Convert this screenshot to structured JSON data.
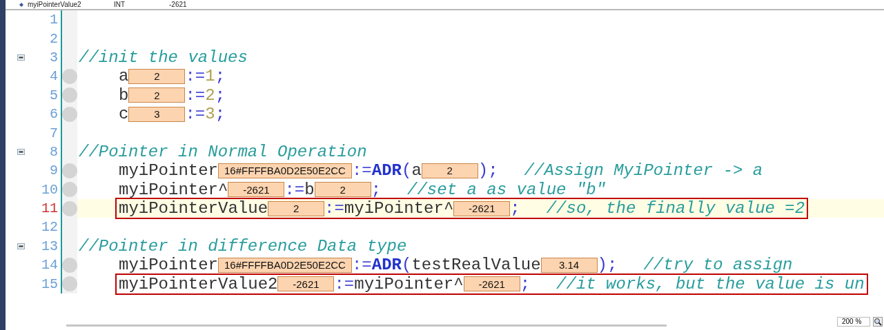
{
  "variables_row": {
    "name": "myiPointerValue2",
    "type": "INT",
    "value": "-2621"
  },
  "lines": [
    {
      "number": "1",
      "foldable": false,
      "breakpoint": false,
      "current": false
    },
    {
      "number": "2",
      "foldable": false,
      "breakpoint": false,
      "current": false
    },
    {
      "number": "3",
      "foldable": true,
      "breakpoint": false,
      "current": false,
      "framed": false,
      "indented": false,
      "tokens": [
        {
          "kind": "comment",
          "text": "//init the values"
        }
      ]
    },
    {
      "number": "4",
      "foldable": false,
      "breakpoint": true,
      "current": false,
      "framed": false,
      "indented": true,
      "tokens": [
        {
          "kind": "ident",
          "text": "a"
        },
        {
          "kind": "value",
          "text": "2"
        },
        {
          "kind": "op",
          "text": ":="
        },
        {
          "kind": "num",
          "text": "1"
        },
        {
          "kind": "punct",
          "text": ";"
        }
      ]
    },
    {
      "number": "5",
      "foldable": false,
      "breakpoint": true,
      "current": false,
      "framed": false,
      "indented": true,
      "tokens": [
        {
          "kind": "ident",
          "text": "b"
        },
        {
          "kind": "value",
          "text": "2"
        },
        {
          "kind": "op",
          "text": ":="
        },
        {
          "kind": "num",
          "text": "2"
        },
        {
          "kind": "punct",
          "text": ";"
        }
      ]
    },
    {
      "number": "6",
      "foldable": false,
      "breakpoint": true,
      "current": false,
      "framed": false,
      "indented": true,
      "tokens": [
        {
          "kind": "ident",
          "text": "c"
        },
        {
          "kind": "value",
          "text": "3"
        },
        {
          "kind": "op",
          "text": ":="
        },
        {
          "kind": "num",
          "text": "3"
        },
        {
          "kind": "punct",
          "text": ";"
        }
      ]
    },
    {
      "number": "7",
      "foldable": false,
      "breakpoint": false,
      "current": false
    },
    {
      "number": "8",
      "foldable": true,
      "breakpoint": false,
      "current": false,
      "framed": false,
      "indented": false,
      "tokens": [
        {
          "kind": "comment",
          "text": "//Pointer in Normal Operation"
        }
      ]
    },
    {
      "number": "9",
      "foldable": false,
      "breakpoint": true,
      "current": false,
      "framed": false,
      "indented": true,
      "tokens": [
        {
          "kind": "ident",
          "text": "myiPointer"
        },
        {
          "kind": "value",
          "text": "16#FFFFBA0D2E50E2CC"
        },
        {
          "kind": "op",
          "text": ":="
        },
        {
          "kind": "kw",
          "text": "ADR"
        },
        {
          "kind": "punct",
          "text": "("
        },
        {
          "kind": "ident",
          "text": "a"
        },
        {
          "kind": "value",
          "text": "2"
        },
        {
          "kind": "punct",
          "text": ");"
        },
        {
          "kind": "comment",
          "text": "//Assign MyiPointer -> a"
        }
      ]
    },
    {
      "number": "10",
      "foldable": false,
      "breakpoint": true,
      "current": false,
      "framed": false,
      "indented": true,
      "tokens": [
        {
          "kind": "ident",
          "text": "myiPointer^"
        },
        {
          "kind": "value",
          "text": "-2621"
        },
        {
          "kind": "op",
          "text": ":="
        },
        {
          "kind": "ident",
          "text": "b"
        },
        {
          "kind": "value",
          "text": "2"
        },
        {
          "kind": "punct",
          "text": ";"
        },
        {
          "kind": "comment",
          "text": "//set a as value \"b\""
        }
      ]
    },
    {
      "number": "11",
      "foldable": false,
      "breakpoint": true,
      "current": true,
      "framed": true,
      "indented": true,
      "tokens": [
        {
          "kind": "ident",
          "text": "myiPointerValue"
        },
        {
          "kind": "value",
          "text": "2"
        },
        {
          "kind": "op",
          "text": ":="
        },
        {
          "kind": "ident",
          "text": "myiPointer^"
        },
        {
          "kind": "value",
          "text": "-2621"
        },
        {
          "kind": "punct",
          "text": ";"
        },
        {
          "kind": "comment",
          "text": "//so, the finally value =2"
        }
      ]
    },
    {
      "number": "12",
      "foldable": false,
      "breakpoint": false,
      "current": false
    },
    {
      "number": "13",
      "foldable": true,
      "breakpoint": false,
      "current": false,
      "framed": false,
      "indented": false,
      "tokens": [
        {
          "kind": "comment",
          "text": "//Pointer in difference Data type"
        }
      ]
    },
    {
      "number": "14",
      "foldable": false,
      "breakpoint": true,
      "current": false,
      "framed": false,
      "indented": true,
      "tokens": [
        {
          "kind": "ident",
          "text": "myiPointer"
        },
        {
          "kind": "value",
          "text": "16#FFFFBA0D2E50E2CC"
        },
        {
          "kind": "op",
          "text": ":="
        },
        {
          "kind": "kw",
          "text": "ADR"
        },
        {
          "kind": "punct",
          "text": "("
        },
        {
          "kind": "ident",
          "text": "testRealValue"
        },
        {
          "kind": "value",
          "text": "3.14"
        },
        {
          "kind": "punct",
          "text": ");"
        },
        {
          "kind": "comment",
          "text": "//try to assign"
        }
      ]
    },
    {
      "number": "15",
      "foldable": false,
      "breakpoint": true,
      "current": false,
      "framed": true,
      "indented": true,
      "tokens": [
        {
          "kind": "ident",
          "text": "myiPointerValue2"
        },
        {
          "kind": "value",
          "text": "-2621"
        },
        {
          "kind": "op",
          "text": ":="
        },
        {
          "kind": "ident",
          "text": "myiPointer^"
        },
        {
          "kind": "value",
          "text": "-2621"
        },
        {
          "kind": "punct",
          "text": ";"
        },
        {
          "kind": "comment",
          "text": "//it works, but the value is un"
        }
      ]
    }
  ],
  "zoom": "200 %"
}
